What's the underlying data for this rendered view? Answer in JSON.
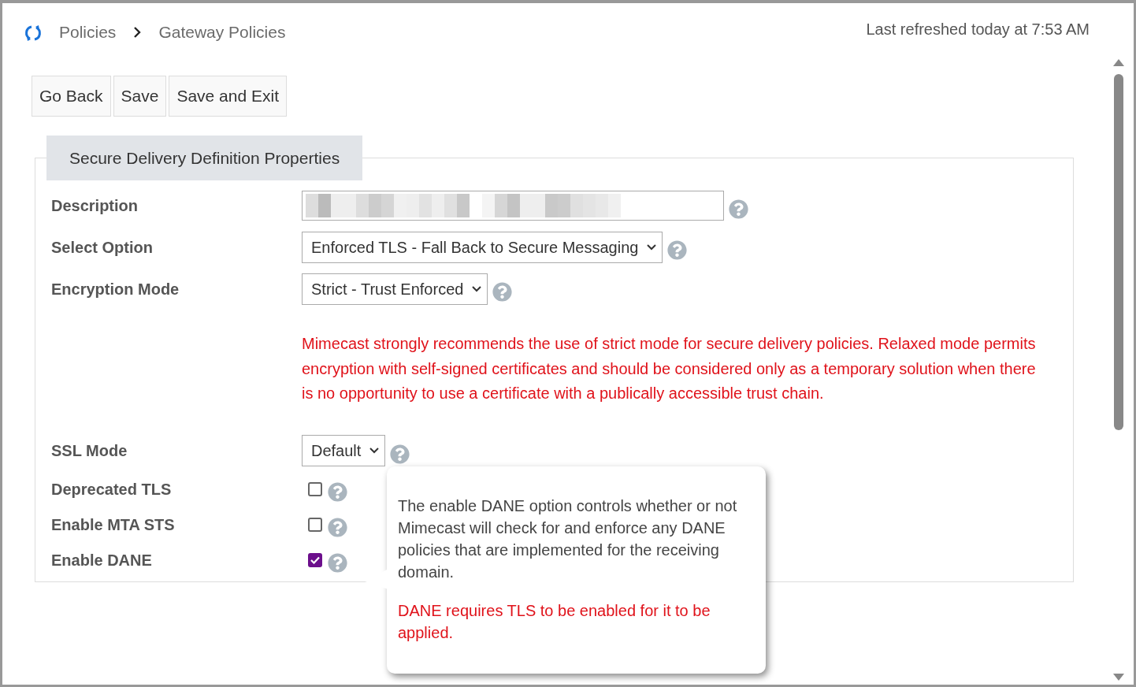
{
  "breadcrumb": [
    {
      "label": "Policies"
    },
    {
      "label": "Gateway Policies"
    }
  ],
  "last_refreshed": "Last refreshed today at 7:53 AM",
  "buttons": [
    "Go Back",
    "Save",
    "Save and Exit"
  ],
  "section": {
    "title": "Secure Delivery Definition Properties",
    "fields": [
      {
        "kind": "blurred",
        "label": "Description"
      },
      {
        "kind": "select",
        "label": "Select Option",
        "value": "Enforced TLS - Fall Back to Secure Messaging"
      },
      {
        "kind": "select",
        "label": "Encryption Mode",
        "value": "Strict - Trust Enforced"
      },
      {
        "kind": "note",
        "text": "Mimecast strongly recommends the use of strict mode for secure delivery policies. Relaxed mode permits encryption with self-signed certificates and should be considered only as a temporary solution when there is no opportunity to use a certificate with a publically accessible trust chain."
      },
      {
        "kind": "select",
        "label": "SSL Mode",
        "value": "Default"
      },
      {
        "kind": "checkbox",
        "label": "Deprecated TLS",
        "checked": false
      },
      {
        "kind": "checkbox",
        "label": "Enable MTA STS",
        "checked": false
      },
      {
        "kind": "checkbox",
        "label": "Enable DANE",
        "checked": true
      }
    ]
  },
  "tooltip": {
    "text": "The enable DANE option controls whether or not Mimecast will check for and enforce any DANE policies that are implemented for the receiving domain.",
    "warning": "DANE requires TLS to be enabled for it to be applied."
  }
}
